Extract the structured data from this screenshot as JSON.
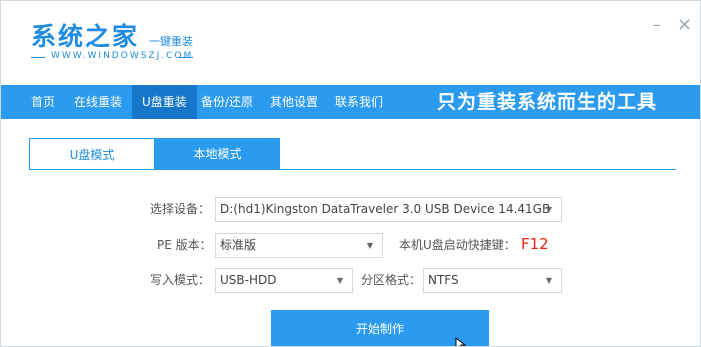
{
  "brand": {
    "title": "系统之家",
    "tagline": "一键重装",
    "url": "WWW.WINDOWSZJ.COM"
  },
  "window_controls": {
    "minimize": "–",
    "close": "×"
  },
  "nav": {
    "items": [
      {
        "label": "首页"
      },
      {
        "label": "在线重装"
      },
      {
        "label": "U盘重装"
      },
      {
        "label": "备份/还原"
      },
      {
        "label": "其他设置"
      },
      {
        "label": "联系我们"
      }
    ],
    "active_index": 2,
    "slogan": "只为重装系统而生的工具"
  },
  "tabs": [
    {
      "label": "U盘模式",
      "active": true
    },
    {
      "label": "本地模式",
      "active": false
    }
  ],
  "form": {
    "device_label": "选择设备：",
    "device_value": "D:(hd1)Kingston DataTraveler 3.0 USB Device 14.41GB",
    "pe_label": "PE 版本：",
    "pe_value": "标准版",
    "hotkey_label": "本机U盘启动快捷键：",
    "hotkey_value": "F12",
    "write_mode_label": "写入模式：",
    "write_mode_value": "USB-HDD",
    "partition_label": "分区格式：",
    "partition_value": "NTFS"
  },
  "start_button": "开始制作",
  "colors": {
    "primary": "#2b9bef",
    "nav_active": "#1676c9",
    "hotkey": "#e8230f",
    "brand": "#1f8ce0"
  }
}
